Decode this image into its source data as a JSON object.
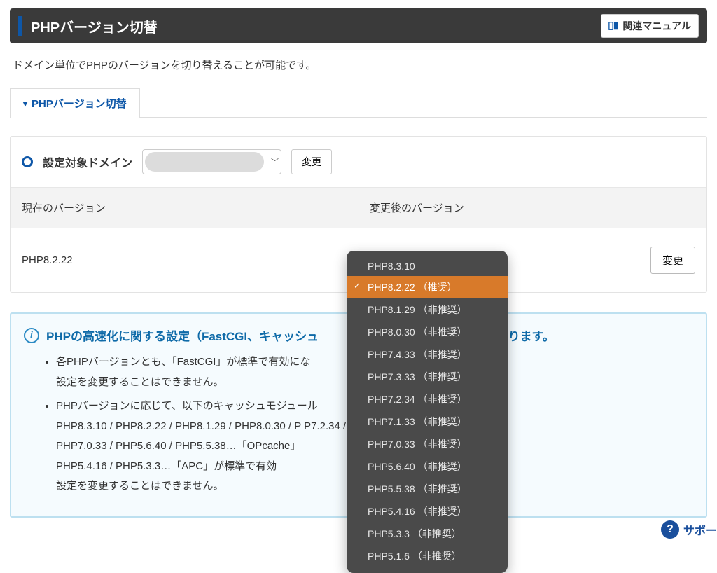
{
  "header": {
    "title": "PHPバージョン切替",
    "manual_button": "関連マニュアル"
  },
  "description": "ドメイン単位でPHPのバージョンを切り替えることが可能です。",
  "tab": {
    "label": "PHPバージョン切替"
  },
  "domain": {
    "label": "設定対象ドメイン",
    "change_btn": "変更"
  },
  "version_table": {
    "current_header": "現在のバージョン",
    "new_header": "変更後のバージョン",
    "current_value": "PHP8.2.22",
    "change_btn": "変更"
  },
  "dropdown": {
    "selected_index": 1,
    "items": [
      "PHP8.3.10",
      "PHP8.2.22 （推奨）",
      "PHP8.1.29 （非推奨）",
      "PHP8.0.30 （非推奨）",
      "PHP7.4.33 （非推奨）",
      "PHP7.3.33 （非推奨）",
      "PHP7.2.34 （非推奨）",
      "PHP7.1.33 （非推奨）",
      "PHP7.0.33 （非推奨）",
      "PHP5.6.40 （非推奨）",
      "PHP5.5.38 （非推奨）",
      "PHP5.4.16 （非推奨）",
      "PHP5.3.3 （非推奨）",
      "PHP5.1.6 （非推奨）"
    ]
  },
  "info": {
    "title_prefix": "PHPの高速化に関する設定（FastCGI、キャッシュ",
    "title_suffix": "になります。",
    "bullets": [
      "各PHPバージョンとも、「FastCGI」が標準で有効にな\n設定を変更することはできません。",
      "PHPバージョンに応じて、以下のキャッシュモジュール\nPHP8.3.10 / PHP8.2.22 / PHP8.1.29 / PHP8.0.30 / P                              P7.2.34 / PHP7.1.33 /\nPHP7.0.33 / PHP5.6.40 / PHP5.5.38…「OPcache」\nPHP5.4.16 / PHP5.3.3…「APC」が標準で有効\n設定を変更することはできません。"
    ]
  },
  "support_fab": "サポー"
}
